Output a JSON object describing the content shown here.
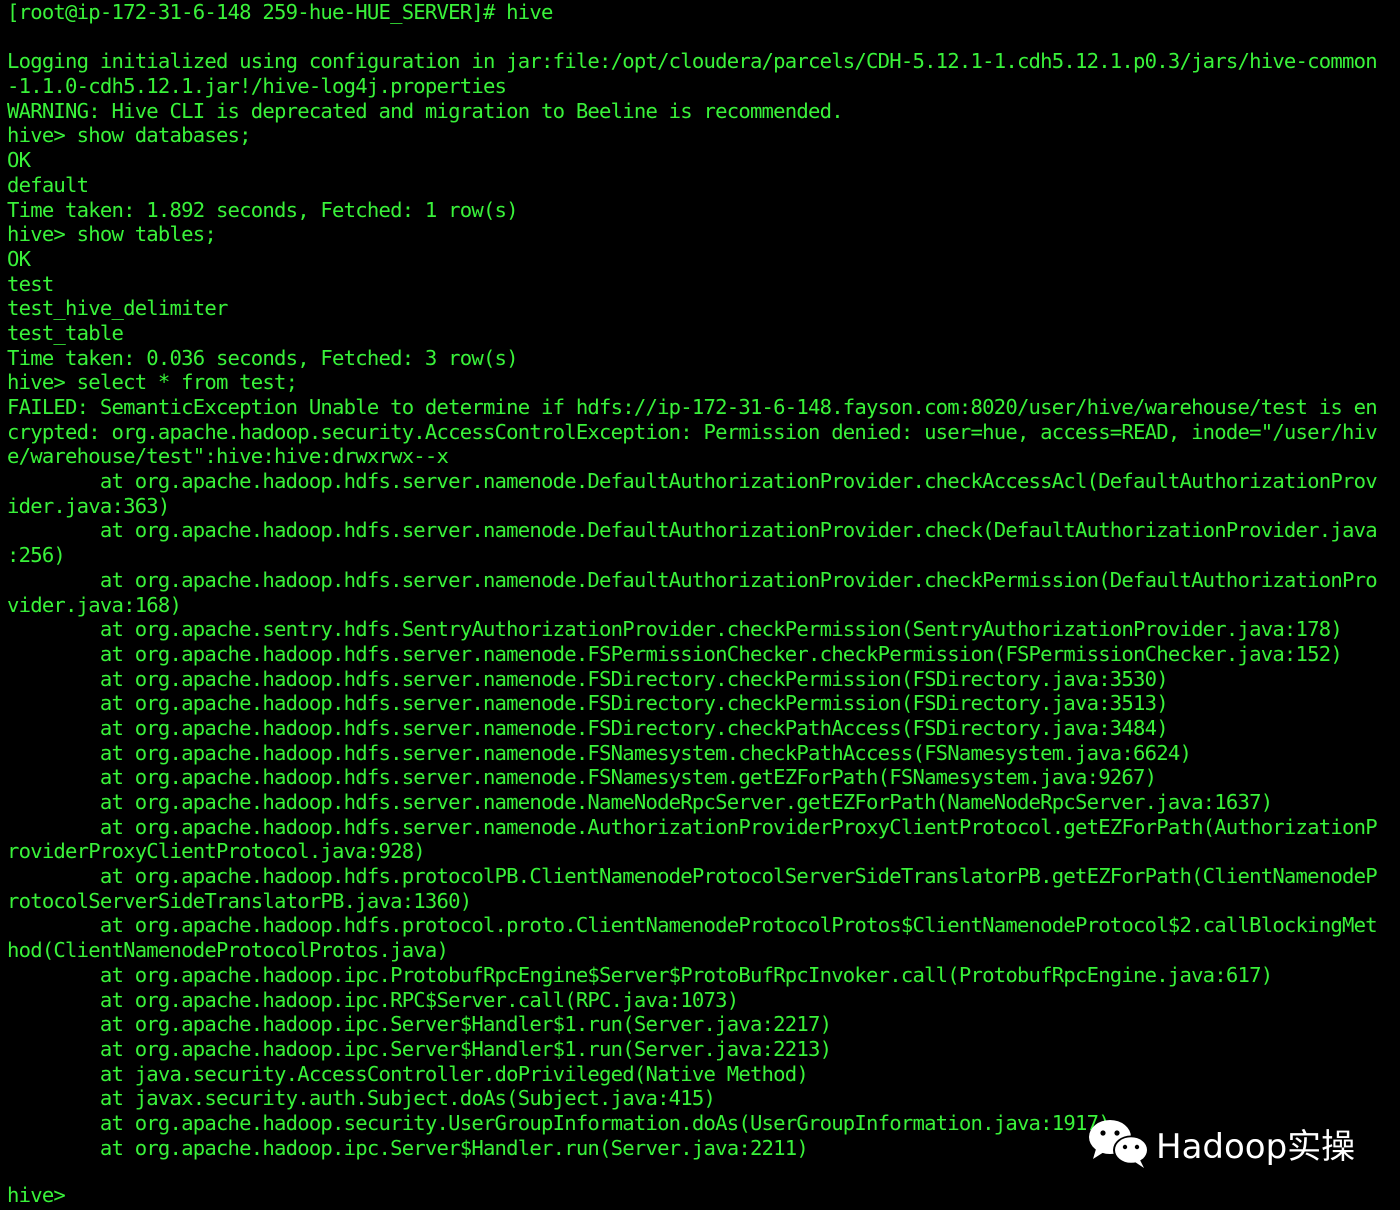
{
  "terminal": {
    "lines": [
      "[root@ip-172-31-6-148 259-hue-HUE_SERVER]# hive",
      "",
      "Logging initialized using configuration in jar:file:/opt/cloudera/parcels/CDH-5.12.1-1.cdh5.12.1.p0.3/jars/hive-common",
      "-1.1.0-cdh5.12.1.jar!/hive-log4j.properties",
      "WARNING: Hive CLI is deprecated and migration to Beeline is recommended.",
      "hive> show databases;",
      "OK",
      "default",
      "Time taken: 1.892 seconds, Fetched: 1 row(s)",
      "hive> show tables;",
      "OK",
      "test",
      "test_hive_delimiter",
      "test_table",
      "Time taken: 0.036 seconds, Fetched: 3 row(s)",
      "hive> select * from test;",
      "FAILED: SemanticException Unable to determine if hdfs://ip-172-31-6-148.fayson.com:8020/user/hive/warehouse/test is en",
      "crypted: org.apache.hadoop.security.AccessControlException: Permission denied: user=hue, access=READ, inode=\"/user/hiv",
      "e/warehouse/test\":hive:hive:drwxrwx--x",
      "        at org.apache.hadoop.hdfs.server.namenode.DefaultAuthorizationProvider.checkAccessAcl(DefaultAuthorizationProv",
      "ider.java:363)",
      "        at org.apache.hadoop.hdfs.server.namenode.DefaultAuthorizationProvider.check(DefaultAuthorizationProvider.java",
      ":256)",
      "        at org.apache.hadoop.hdfs.server.namenode.DefaultAuthorizationProvider.checkPermission(DefaultAuthorizationPro",
      "vider.java:168)",
      "        at org.apache.sentry.hdfs.SentryAuthorizationProvider.checkPermission(SentryAuthorizationProvider.java:178)",
      "        at org.apache.hadoop.hdfs.server.namenode.FSPermissionChecker.checkPermission(FSPermissionChecker.java:152)",
      "        at org.apache.hadoop.hdfs.server.namenode.FSDirectory.checkPermission(FSDirectory.java:3530)",
      "        at org.apache.hadoop.hdfs.server.namenode.FSDirectory.checkPermission(FSDirectory.java:3513)",
      "        at org.apache.hadoop.hdfs.server.namenode.FSDirectory.checkPathAccess(FSDirectory.java:3484)",
      "        at org.apache.hadoop.hdfs.server.namenode.FSNamesystem.checkPathAccess(FSNamesystem.java:6624)",
      "        at org.apache.hadoop.hdfs.server.namenode.FSNamesystem.getEZForPath(FSNamesystem.java:9267)",
      "        at org.apache.hadoop.hdfs.server.namenode.NameNodeRpcServer.getEZForPath(NameNodeRpcServer.java:1637)",
      "        at org.apache.hadoop.hdfs.server.namenode.AuthorizationProviderProxyClientProtocol.getEZForPath(AuthorizationP",
      "roviderProxyClientProtocol.java:928)",
      "        at org.apache.hadoop.hdfs.protocolPB.ClientNamenodeProtocolServerSideTranslatorPB.getEZForPath(ClientNamenodeP",
      "rotocolServerSideTranslatorPB.java:1360)",
      "        at org.apache.hadoop.hdfs.protocol.proto.ClientNamenodeProtocolProtos$ClientNamenodeProtocol$2.callBlockingMet",
      "hod(ClientNamenodeProtocolProtos.java)",
      "        at org.apache.hadoop.ipc.ProtobufRpcEngine$Server$ProtoBufRpcInvoker.call(ProtobufRpcEngine.java:617)",
      "        at org.apache.hadoop.ipc.RPC$Server.call(RPC.java:1073)",
      "        at org.apache.hadoop.ipc.Server$Handler$1.run(Server.java:2217)",
      "        at org.apache.hadoop.ipc.Server$Handler$1.run(Server.java:2213)",
      "        at java.security.AccessController.doPrivileged(Native Method)",
      "        at javax.security.auth.Subject.doAs(Subject.java:415)",
      "        at org.apache.hadoop.security.UserGroupInformation.doAs(UserGroupInformation.java:1917)",
      "        at org.apache.hadoop.ipc.Server$Handler.run(Server.java:2211)",
      ""
    ],
    "prompt": "hive>",
    "text_color": "#39f23a",
    "background_color": "#000000"
  },
  "watermark": {
    "icon": "wechat-icon",
    "text": "Hadoop实操"
  }
}
